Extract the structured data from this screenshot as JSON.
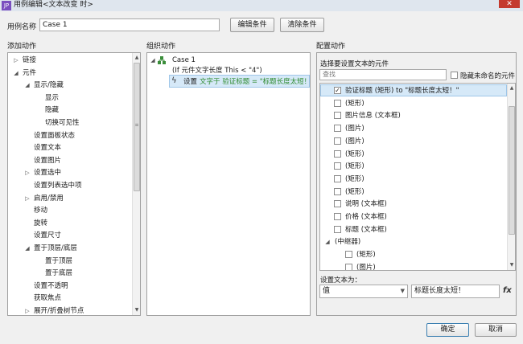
{
  "window": {
    "title": "用例编辑<文本改变 时>",
    "close": "✕",
    "app_icon": "JP"
  },
  "case_name": {
    "label": "用例名称",
    "value": "Case 1"
  },
  "buttons": {
    "edit_condition": "编辑条件",
    "clear_condition": "清除条件",
    "ok": "确定",
    "cancel": "取消"
  },
  "add_actions": {
    "title": "添加动作",
    "items": [
      {
        "label": "链接",
        "indent": 0,
        "arrow": "right"
      },
      {
        "label": "元件",
        "indent": 0,
        "arrow": "down"
      },
      {
        "label": "显示/隐藏",
        "indent": 1,
        "arrow": "down"
      },
      {
        "label": "显示",
        "indent": 2,
        "arrow": ""
      },
      {
        "label": "隐藏",
        "indent": 2,
        "arrow": ""
      },
      {
        "label": "切换可见性",
        "indent": 2,
        "arrow": ""
      },
      {
        "label": "设置面板状态",
        "indent": 1,
        "arrow": ""
      },
      {
        "label": "设置文本",
        "indent": 1,
        "arrow": ""
      },
      {
        "label": "设置图片",
        "indent": 1,
        "arrow": ""
      },
      {
        "label": "设置选中",
        "indent": 1,
        "arrow": "right"
      },
      {
        "label": "设置列表选中项",
        "indent": 1,
        "arrow": ""
      },
      {
        "label": "启用/禁用",
        "indent": 1,
        "arrow": "right"
      },
      {
        "label": "移动",
        "indent": 1,
        "arrow": ""
      },
      {
        "label": "旋转",
        "indent": 1,
        "arrow": ""
      },
      {
        "label": "设置尺寸",
        "indent": 1,
        "arrow": ""
      },
      {
        "label": "置于顶层/底层",
        "indent": 1,
        "arrow": "down"
      },
      {
        "label": "置于顶层",
        "indent": 2,
        "arrow": ""
      },
      {
        "label": "置于底层",
        "indent": 2,
        "arrow": ""
      },
      {
        "label": "设置不透明",
        "indent": 1,
        "arrow": ""
      },
      {
        "label": "获取焦点",
        "indent": 1,
        "arrow": ""
      },
      {
        "label": "展开/折叠树节点",
        "indent": 1,
        "arrow": "right"
      }
    ]
  },
  "organize_actions": {
    "title": "组织动作",
    "case_label": "Case 1",
    "case_condition": "(If 元件文字长度 This < \"4\")",
    "action_prefix": "设置",
    "action_text": "文字于 验证标题 = \"标题长度太短！\""
  },
  "config_actions": {
    "title": "配置动作",
    "choose_label": "选择要设置文本的元件",
    "search_placeholder": "查找",
    "hide_unnamed": "隐藏未命名的元件",
    "widgets": [
      {
        "label": "验证标题 (矩形) to \"标题长度太短！\"",
        "checked": true,
        "indent": 0,
        "selected": true,
        "arrow": ""
      },
      {
        "label": "(矩形)",
        "checked": false,
        "indent": 0,
        "selected": false,
        "arrow": ""
      },
      {
        "label": "图片信息 (文本框)",
        "checked": false,
        "indent": 0,
        "selected": false,
        "arrow": ""
      },
      {
        "label": "(图片)",
        "checked": false,
        "indent": 0,
        "selected": false,
        "arrow": ""
      },
      {
        "label": "(图片)",
        "checked": false,
        "indent": 0,
        "selected": false,
        "arrow": ""
      },
      {
        "label": "(矩形)",
        "checked": false,
        "indent": 0,
        "selected": false,
        "arrow": ""
      },
      {
        "label": "(矩形)",
        "checked": false,
        "indent": 0,
        "selected": false,
        "arrow": ""
      },
      {
        "label": "(矩形)",
        "checked": false,
        "indent": 0,
        "selected": false,
        "arrow": ""
      },
      {
        "label": "(矩形)",
        "checked": false,
        "indent": 0,
        "selected": false,
        "arrow": ""
      },
      {
        "label": "说明 (文本框)",
        "checked": false,
        "indent": 0,
        "selected": false,
        "arrow": ""
      },
      {
        "label": "价格 (文本框)",
        "checked": false,
        "indent": 0,
        "selected": false,
        "arrow": ""
      },
      {
        "label": "标题 (文本框)",
        "checked": false,
        "indent": 0,
        "selected": false,
        "arrow": ""
      },
      {
        "label": "(中继器)",
        "checked": null,
        "indent": -1,
        "selected": false,
        "arrow": "down"
      },
      {
        "label": "(矩形)",
        "checked": false,
        "indent": 1,
        "selected": false,
        "arrow": ""
      },
      {
        "label": "(图片)",
        "checked": false,
        "indent": 1,
        "selected": false,
        "arrow": ""
      }
    ],
    "set_text_label": "设置文本为：",
    "value_type": "值",
    "value_text": "标题长度太短！",
    "fx": "fx"
  }
}
